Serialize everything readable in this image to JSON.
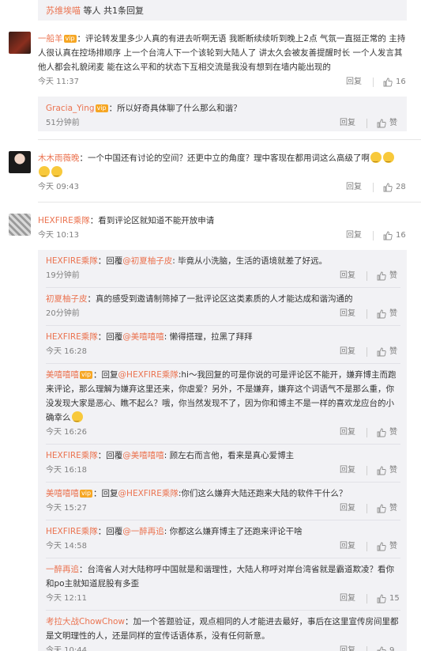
{
  "top_summary": {
    "users": "苏维埃喵",
    "suffix": " 等人 ",
    "more": "共1条回复"
  },
  "labels": {
    "reply": "回复",
    "like": "赞"
  },
  "comments": [
    {
      "user": "一船羊",
      "vip": "vip",
      "text": "：评论转发里多少人真的有进去听啊无语 我断断续续听到晚上2点 气氛一直挺正常的 主持人很认真在控场排顺序 上一个台湾人下一个该轮到大陆人了 讲太久会被友善提醒时长 一个人发言其他人都会礼貌闭麦 能在这么平和的状态下互相交流是我没有想到在墙内能出现的",
      "time": "今天 11:37",
      "likes": "16",
      "replies": [
        {
          "user": "Gracia_Ying",
          "vip": "vip",
          "text": "：所以好奇具体聊了什么那么和谐？",
          "time": "51分钟前",
          "likes": "赞"
        }
      ]
    },
    {
      "user": "木木雨薇晚",
      "text": "：一个中国还有讨论的空间？还更中立的角度？理中客现在都用词这么高级了啊",
      "time": "今天 09:43",
      "likes": "28",
      "replies": []
    },
    {
      "user": "HEXFIRE乘隊",
      "text": "：看到评论区就知道不能开放申请",
      "time": "今天 10:13",
      "likes": "16",
      "replies": [
        {
          "user": "HEXFIRE乘隊",
          "pre": "：回覆",
          "at": "@初夏柚子皮",
          "text": ": 毕竟从小洗脑，生活的语境就差了好远。",
          "time": "19分钟前",
          "likes": "赞"
        },
        {
          "user": "初夏柚子皮",
          "text": "：真的感受到邀请制筛掉了一批评论区这类素质的人才能达成和谐沟通的",
          "time": "20分钟前",
          "likes": "赞"
        },
        {
          "user": "HEXFIRE乘隊",
          "pre": "：回覆",
          "at": "@美嘻嘻嘻",
          "text": ": 懒得搭理，拉黑了拜拜",
          "time": "今天 16:28",
          "likes": "赞"
        },
        {
          "user": "美嘻嘻嘻",
          "vip": "vip",
          "pre": "：回复",
          "at": "@HEXFIRE乘隊",
          "text": ":hi～我回复的可是你说的可是评论区不能开，嫌弃博主而跑来评论，那么理解为嫌弃这里还来，你虐爱？另外，不是嫌弃，嫌弃这个词语气不是那么重，你没发现大家是恶心、瞧不起么？哦，你当然发现不了，因为你和博主不是一样的喜欢龙应台的小确幸么",
          "time": "今天 16:26",
          "likes": "赞"
        },
        {
          "user": "HEXFIRE乘隊",
          "pre": "：回覆",
          "at": "@美嘻嘻嘻",
          "text": ": 顾左右而言他，看来是真心爱博主",
          "time": "今天 16:18",
          "likes": "赞"
        },
        {
          "user": "美嘻嘻嘻",
          "vip": "vip",
          "pre": "：回复",
          "at": "@HEXFIRE乘隊",
          "text": ":你们这么嫌弃大陆还跑来大陆的软件干什么？",
          "time": "今天 15:27",
          "likes": "赞"
        },
        {
          "user": "HEXFIRE乘隊",
          "pre": "：回覆",
          "at": "@一醉再追",
          "text": ": 你都这么嫌弃博主了还跑来评论干啥",
          "time": "今天 14:58",
          "likes": "赞"
        },
        {
          "user": "一醉再追",
          "text": "：台湾省人对大陆称呼中国就是和谐理性，大陆人称呼对岸台湾省就是霸道欺凌？看你和po主就知道屁股有多歪",
          "time": "今天 12:11",
          "likes": "15"
        },
        {
          "user": "考拉大战ChowChow",
          "text": "：加一个答题验证，观点相同的人才能进去最好，事后在这里宣传房间里都是文明理性的人，还是同样的宣传话语体系，没有任何新意。",
          "time": "今天 10:44",
          "likes": "9"
        }
      ]
    }
  ]
}
